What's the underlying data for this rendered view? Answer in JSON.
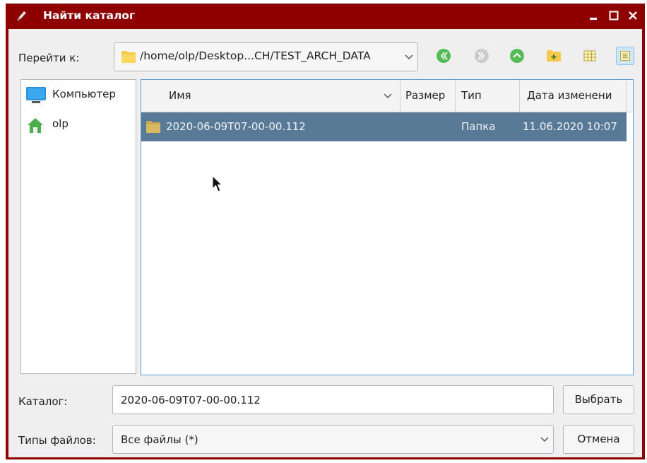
{
  "window": {
    "title": "Найти каталог",
    "title_color": "#8e0000"
  },
  "toolbar": {
    "goto_label": "Перейти к:",
    "path": "/home/olp/Desktop...CH/TEST_ARCH_DATA",
    "buttons": [
      "back-icon",
      "forward-icon",
      "parent-directory-icon",
      "new-folder-icon",
      "icon-view-icon",
      "detail-view-icon"
    ]
  },
  "places": [
    {
      "label": "Компьютер",
      "icon": "computer-icon"
    },
    {
      "label": "olp",
      "icon": "home-icon"
    }
  ],
  "filelist": {
    "columns": [
      "Имя",
      "Размер",
      "Тип",
      "Дата изменени"
    ],
    "rows": [
      {
        "name": "2020-06-09T07-00-00.112",
        "size": "",
        "type": "Папка",
        "date": "11.06.2020 10:07",
        "selected": true
      }
    ],
    "selection_color": "#587a96"
  },
  "footer": {
    "dir_label": "Каталог:",
    "dir_value": "2020-06-09T07-00-00.112",
    "choose_label": "Выбрать",
    "types_label": "Типы файлов:",
    "types_value": "Все файлы (*)",
    "cancel_label": "Отмена"
  }
}
